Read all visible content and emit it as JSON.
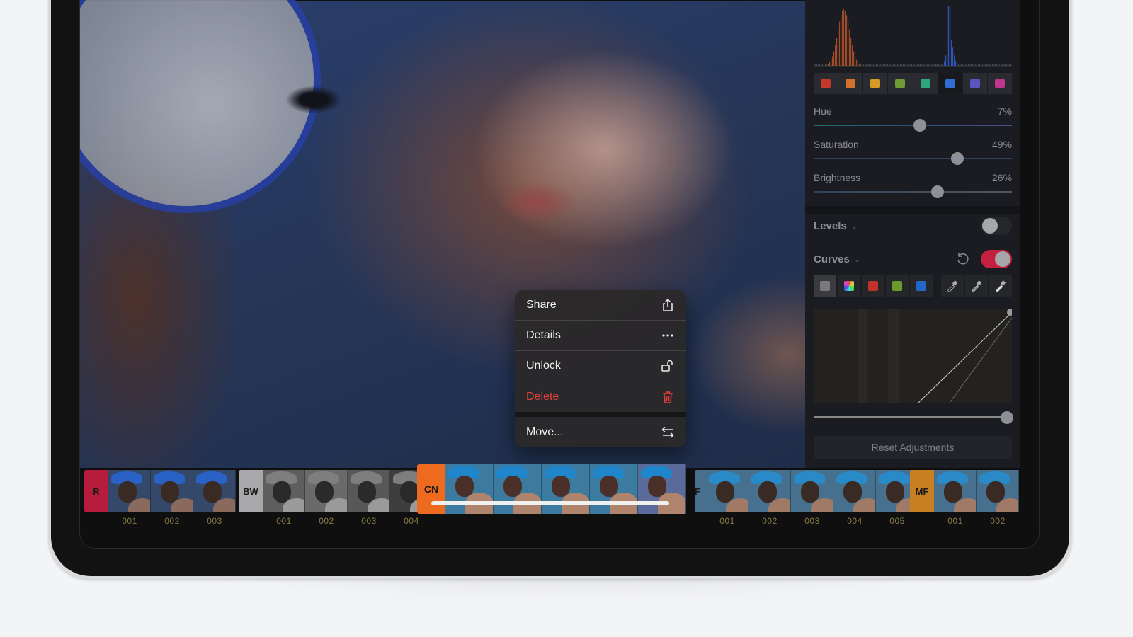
{
  "context_menu": {
    "items": [
      {
        "label": "Share",
        "icon": "share-icon"
      },
      {
        "label": "Details",
        "icon": "ellipsis-icon"
      },
      {
        "label": "Unlock",
        "icon": "unlock-icon"
      },
      {
        "label": "Delete",
        "icon": "trash-icon",
        "destructive": true
      },
      {
        "label": "Move...",
        "icon": "move-arrows-icon"
      }
    ]
  },
  "panel": {
    "color_swatches": [
      "#c5392c",
      "#d2712d",
      "#d49a26",
      "#6e9a35",
      "#2fa57c",
      "#2d6ed0",
      "#5a55c0",
      "#c0368f"
    ],
    "selected_swatch_index": 5,
    "sliders": [
      {
        "label": "Hue",
        "value": "7%",
        "position": 0.535
      },
      {
        "label": "Saturation",
        "value": "49%",
        "position": 0.725
      },
      {
        "label": "Brightness",
        "value": "26%",
        "position": 0.625
      }
    ],
    "levels": {
      "label": "Levels",
      "enabled": false
    },
    "curves": {
      "label": "Curves",
      "enabled": true,
      "channels": [
        "gray",
        "rgb",
        "red",
        "green",
        "blue"
      ],
      "channel_colors": [
        "#7a7a7c",
        "rgb",
        "#c4312a",
        "#6b9a2e",
        "#2166c8"
      ],
      "selected_channel_index": 0,
      "tools": [
        "black-point-dropper-icon",
        "gray-point-dropper-icon",
        "white-point-dropper-icon"
      ]
    },
    "intensity_slider_position": 1.0,
    "reset_label": "Reset Adjustments"
  },
  "filmstrip": {
    "groups": [
      {
        "tag": "R",
        "color": "#b81c3c",
        "tone": "blue",
        "labels": [
          "001",
          "002",
          "003"
        ]
      },
      {
        "tag": "BW",
        "color": "#a9a9ab",
        "tone": "gray",
        "labels": [
          "001",
          "002",
          "003",
          "004"
        ]
      },
      {
        "tag": "CN",
        "color": "#ee6a1e",
        "tone": "teal",
        "labels": [],
        "expanded": true,
        "count": 5
      },
      {
        "tag": "F",
        "color": "#3d6a90",
        "tone": "steel",
        "labels": [
          "001",
          "002",
          "003",
          "004",
          "005"
        ]
      },
      {
        "tag": "MF",
        "color": "#c87f22",
        "tone": "steel",
        "labels": [
          "001",
          "002"
        ]
      }
    ]
  },
  "accent_color": "#c4203f"
}
